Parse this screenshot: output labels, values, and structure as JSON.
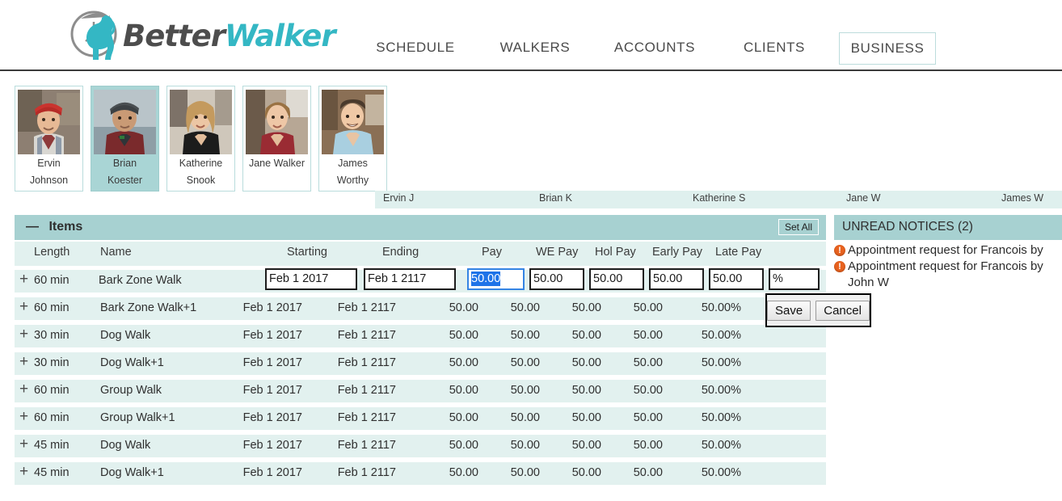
{
  "brand": {
    "name_part1": "Better",
    "name_part2": "Walker",
    "accent": "#34b7c4",
    "dark": "#4d4d4d"
  },
  "nav": {
    "items": [
      {
        "label": "SCHEDULE",
        "active": false
      },
      {
        "label": "WALKERS",
        "active": false
      },
      {
        "label": "ACCOUNTS",
        "active": false
      },
      {
        "label": "CLIENTS",
        "active": false
      },
      {
        "label": "BUSINESS",
        "active": true
      }
    ]
  },
  "walkers": [
    {
      "first": "Ervin",
      "last": "Johnson",
      "selected": false,
      "col_label": "Ervin J"
    },
    {
      "first": "Brian",
      "last": "Koester",
      "selected": true,
      "col_label": "Brian K"
    },
    {
      "first": "Katherine",
      "last": "Snook",
      "selected": false,
      "col_label": "Katherine S"
    },
    {
      "first": "Jane Walker",
      "last": "",
      "selected": false,
      "col_label": "Jane W"
    },
    {
      "first": "James",
      "last": "Worthy",
      "selected": false,
      "col_label": "James W"
    }
  ],
  "items_panel": {
    "collapse_glyph": "—",
    "title": "Items",
    "set_all_label": "Set All",
    "columns": [
      "Length",
      "Name",
      "Starting",
      "Ending",
      "Pay",
      "WE Pay",
      "Hol Pay",
      "Early Pay",
      "Late Pay"
    ],
    "add_glyph": "+",
    "rows": [
      {
        "length": "60 min",
        "name": "Bark Zone Walk",
        "starting": "Feb 1 2017",
        "ending": "Feb 1 2117",
        "pay": "50.00",
        "we_pay": "50.00",
        "hol_pay": "50.00",
        "early_pay": "50.00",
        "late_pay": "50.00",
        "late_pay_display": "50.00%",
        "editing": true
      },
      {
        "length": "60 min",
        "name": "Bark Zone Walk+1",
        "starting": "Feb 1 2017",
        "ending": "Feb 1 2117",
        "pay": "50.00",
        "we_pay": "50.00",
        "hol_pay": "50.00",
        "early_pay": "50.00",
        "late_pay": "50.00",
        "late_pay_display": "50.00%",
        "editing": false
      },
      {
        "length": "30 min",
        "name": "Dog Walk",
        "starting": "Feb 1 2017",
        "ending": "Feb 1 2117",
        "pay": "50.00",
        "we_pay": "50.00",
        "hol_pay": "50.00",
        "early_pay": "50.00",
        "late_pay": "50.00",
        "late_pay_display": "50.00%",
        "editing": false
      },
      {
        "length": "30 min",
        "name": "Dog Walk+1",
        "starting": "Feb 1 2017",
        "ending": "Feb 1 2117",
        "pay": "50.00",
        "we_pay": "50.00",
        "hol_pay": "50.00",
        "early_pay": "50.00",
        "late_pay": "50.00",
        "late_pay_display": "50.00%",
        "editing": false
      },
      {
        "length": "60 min",
        "name": "Group Walk",
        "starting": "Feb 1 2017",
        "ending": "Feb 1 2117",
        "pay": "50.00",
        "we_pay": "50.00",
        "hol_pay": "50.00",
        "early_pay": "50.00",
        "late_pay": "50.00",
        "late_pay_display": "50.00%",
        "editing": false
      },
      {
        "length": "60 min",
        "name": "Group Walk+1",
        "starting": "Feb 1 2017",
        "ending": "Feb 1 2117",
        "pay": "50.00",
        "we_pay": "50.00",
        "hol_pay": "50.00",
        "early_pay": "50.00",
        "late_pay": "50.00",
        "late_pay_display": "50.00%",
        "editing": false
      },
      {
        "length": "45 min",
        "name": "Dog Walk",
        "starting": "Feb 1 2017",
        "ending": "Feb 1 2117",
        "pay": "50.00",
        "we_pay": "50.00",
        "hol_pay": "50.00",
        "early_pay": "50.00",
        "late_pay": "50.00",
        "late_pay_display": "50.00%",
        "editing": false
      },
      {
        "length": "45 min",
        "name": "Dog Walk+1",
        "starting": "Feb 1 2017",
        "ending": "Feb 1 2117",
        "pay": "50.00",
        "we_pay": "50.00",
        "hol_pay": "50.00",
        "early_pay": "50.00",
        "late_pay": "50.00",
        "late_pay_display": "50.00%",
        "editing": false
      }
    ]
  },
  "edit_row": {
    "starting": "Feb 1 2017",
    "ending": "Feb 1 2117",
    "pay_selected_text": "50.00",
    "we_pay": "50.00",
    "hol_pay": "50.00",
    "early_pay": "50.00",
    "late_pay": "50.00",
    "percent": "%",
    "save_label": "Save",
    "cancel_label": "Cancel"
  },
  "notices": {
    "title": "UNREAD NOTICES (2)",
    "badge_glyph": "!",
    "items": [
      "Appointment request for Francois by",
      "Appointment request for Francois by John W"
    ]
  },
  "colors": {
    "band_light": "#e2f1ef",
    "band_teal": "#a7d1d1",
    "col_band": "#dff0ee",
    "notice_badge": "#e8621f",
    "focus_blue": "#1e73e8"
  }
}
